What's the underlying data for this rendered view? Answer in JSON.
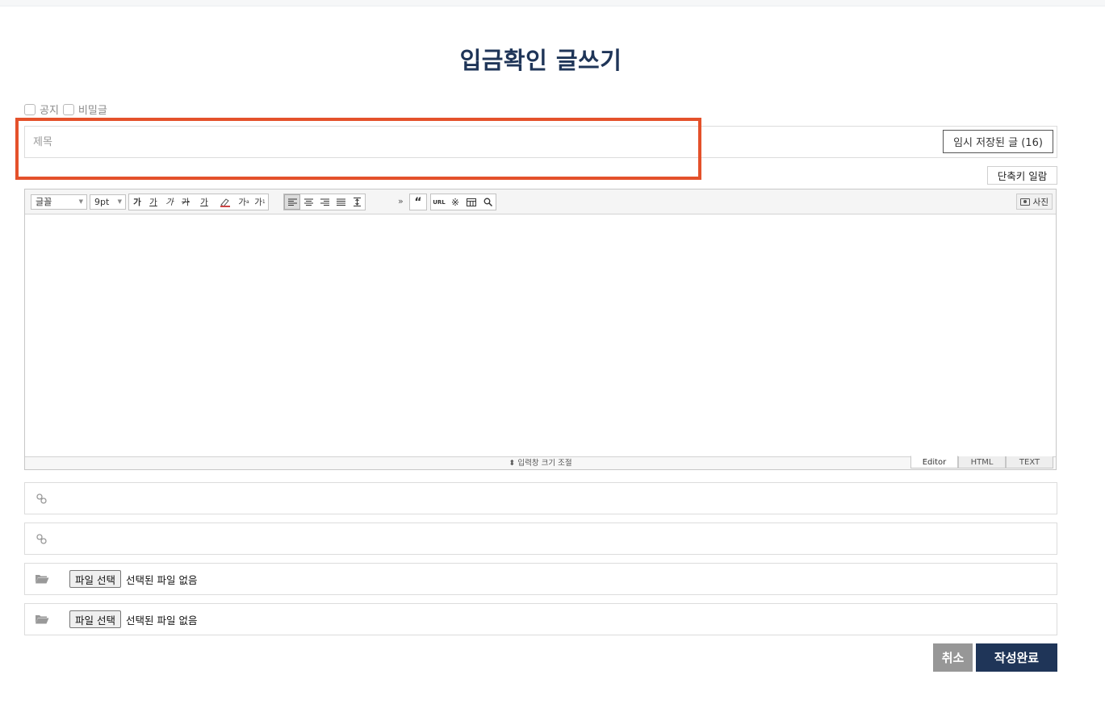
{
  "page": {
    "title": "입금확인 글쓰기"
  },
  "options": {
    "notice_label": "공지",
    "secret_label": "비밀글"
  },
  "subject": {
    "placeholder": "제목",
    "value": "",
    "autosave_label": "임시 저장된 글 (16)"
  },
  "shortcut_label": "단축키 일람",
  "editor": {
    "font_select": "글꼴",
    "size_select": "9pt",
    "format_buttons": [
      "가",
      "가",
      "가",
      "가",
      "가"
    ],
    "superscript": "가",
    "subscript": "가",
    "more": "»",
    "quote": "“",
    "url": "URL",
    "photo_label": "사진",
    "resize_label": "⬍ 입력창 크기 조절",
    "modes": [
      "Editor",
      "HTML",
      "TEXT"
    ],
    "active_mode": "Editor"
  },
  "links": [
    {
      "value": ""
    },
    {
      "value": ""
    }
  ],
  "files": [
    {
      "button": "파일 선택",
      "status": "선택된 파일 없음"
    },
    {
      "button": "파일 선택",
      "status": "선택된 파일 없음"
    }
  ],
  "actions": {
    "cancel": "취소",
    "submit": "작성완료"
  },
  "colors": {
    "brand": "#1f3558",
    "highlight": "#e4512b",
    "cancel": "#979797"
  }
}
